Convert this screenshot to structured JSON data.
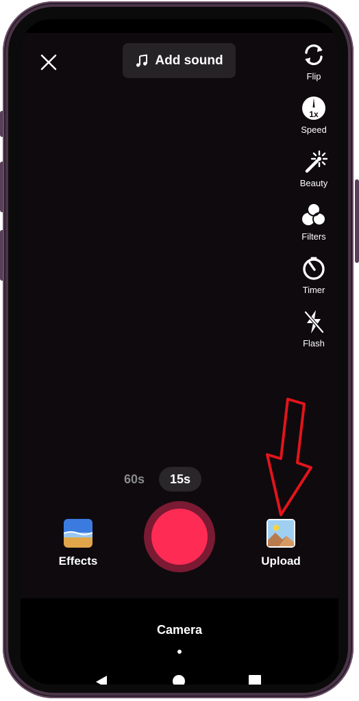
{
  "top_bar": {
    "close_icon": "close-icon",
    "add_sound_label": "Add sound",
    "add_sound_icon": "music-note-icon"
  },
  "right_rail": {
    "flip_label": "Flip",
    "speed_label": "Speed",
    "speed_value": "1x",
    "beauty_label": "Beauty",
    "filters_label": "Filters",
    "timer_label": "Timer",
    "flash_label": "Flash"
  },
  "duration": {
    "options": [
      "60s",
      "15s"
    ],
    "selected": "15s"
  },
  "bottom_controls": {
    "effects_label": "Effects",
    "upload_label": "Upload",
    "record_color": "#fe2c55"
  },
  "mode": {
    "label": "Camera"
  },
  "annotation": {
    "color": "#e3141b",
    "target": "Upload"
  }
}
